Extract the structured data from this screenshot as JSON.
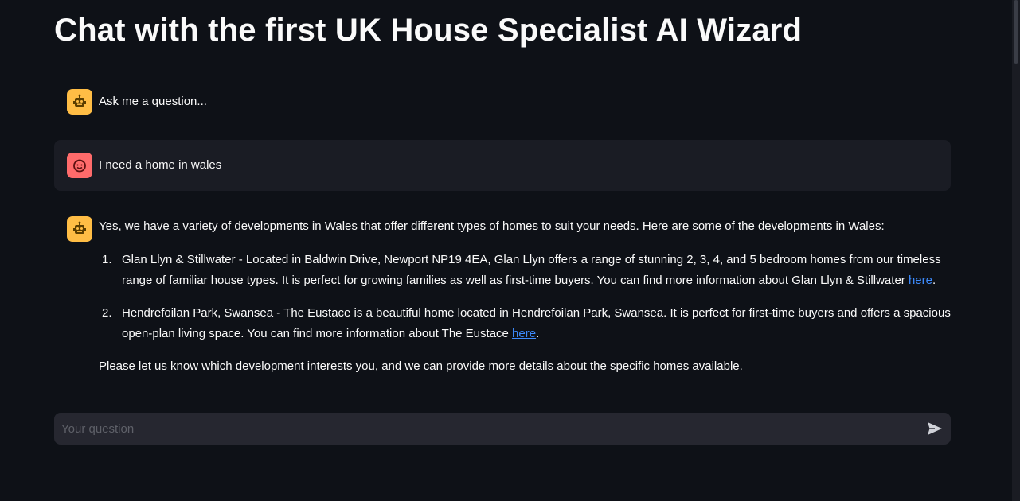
{
  "page": {
    "title": "Chat with the first UK House Specialist AI Wizard"
  },
  "messages": {
    "greeting": {
      "role": "assistant",
      "avatar_icon": "robot-icon",
      "text": "Ask me a question..."
    },
    "user": {
      "role": "user",
      "avatar_icon": "smiley-face-icon",
      "text": "I need a home in wales"
    },
    "answer": {
      "role": "assistant",
      "avatar_icon": "robot-icon",
      "intro": "Yes, we have a variety of developments in Wales that offer different types of homes to suit your needs. Here are some of the developments in Wales:",
      "items": [
        {
          "number": "1.",
          "text_line1": "Glan Llyn & Stillwater - Located in Baldwin Drive, Newport NP19 4EA, Glan Llyn offers a range of stunning 2, 3, 4, and 5 bedroom homes from our timeless",
          "text_line2": "range of familiar house types. It is perfect for growing families as well as first-time buyers. You can find more information about Glan Llyn & Stillwater ",
          "link": "here",
          "after": "."
        },
        {
          "number": "2.",
          "text_line1": "Hendrefoilan Park, Swansea - The Eustace is a beautiful home located in Hendrefoilan Park, Swansea. It is perfect for first-time buyers and offers a spacious",
          "text_line2": "open-plan living space. You can find more information about The Eustace ",
          "link": "here",
          "after": "."
        }
      ],
      "outro": "Please let us know which development interests you, and we can provide more details about the specific homes available."
    }
  },
  "chat_input": {
    "placeholder": "Your question",
    "value": "",
    "send_icon": "send-icon"
  },
  "colors": {
    "background": "#0e1117",
    "bot_avatar": "#ffbd45",
    "user_avatar": "#ff6b6b",
    "link": "#3d8bfd",
    "input_background": "#262730"
  }
}
